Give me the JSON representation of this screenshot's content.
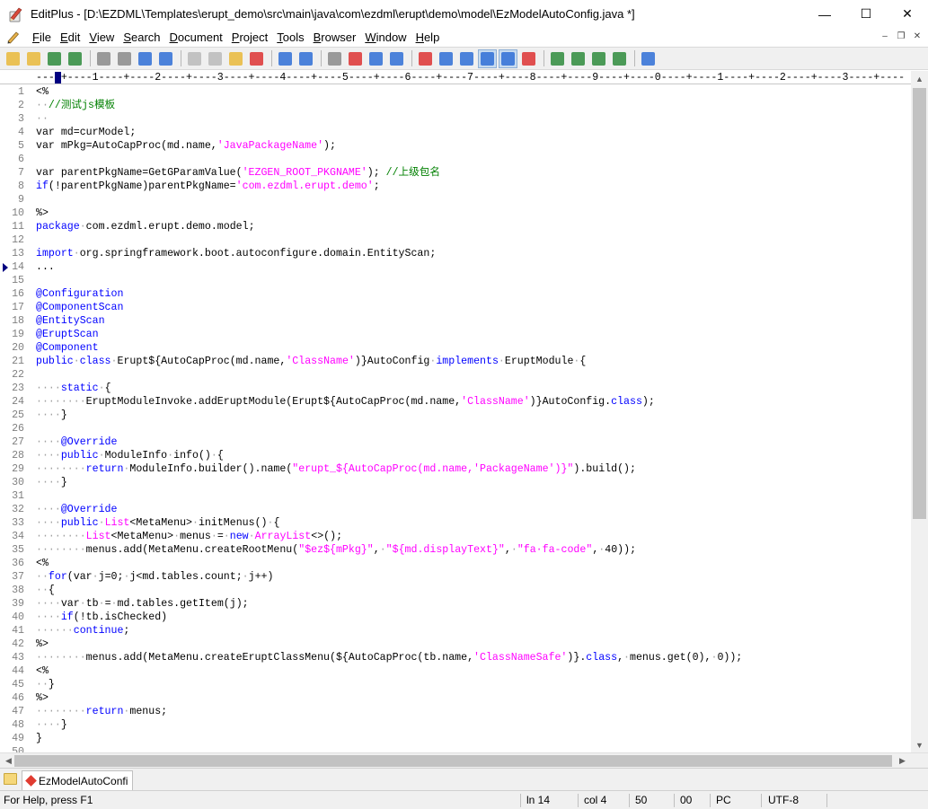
{
  "window": {
    "title": "EditPlus - [D:\\EZDML\\Templates\\erupt_demo\\src\\main\\java\\com\\ezdml\\erupt\\demo\\model\\EzModelAutoConfig.java *]",
    "minimize_glyph": "—",
    "maximize_glyph": "☐",
    "close_glyph": "✕"
  },
  "menu": {
    "items": [
      "File",
      "Edit",
      "View",
      "Search",
      "Document",
      "Project",
      "Tools",
      "Browser",
      "Window",
      "Help"
    ],
    "mdi_minimize": "–",
    "mdi_restore": "❐",
    "mdi_close": "✕"
  },
  "toolbar": {
    "icons": [
      "new-file-icon",
      "open-file-icon",
      "save-icon",
      "save-all-icon",
      "print-preview-icon",
      "print-icon",
      "spell-check-icon",
      "browser-preview-icon",
      "cut-icon",
      "copy-icon",
      "paste-icon",
      "delete-icon",
      "undo-icon",
      "redo-icon",
      "find-icon",
      "replace-icon",
      "find-in-files-icon",
      "go-to-icon",
      "font-icon",
      "hx-icon",
      "word-wrap-icon",
      "line-numbers-icon",
      "ruler-icon",
      "check-icon",
      "cliptext-icon",
      "directory-icon",
      "output-icon",
      "full-screen-icon",
      "help-icon"
    ],
    "colors": {
      "blue": "#2f6fd6",
      "green": "#2e8b3c",
      "red": "#d33",
      "yellow": "#e9b93a",
      "gray": "#8a8a8a"
    }
  },
  "ruler": {
    "text": "----+----1----+----2----+----3----+----4----+----5----+----6----+----7----+----8----+----9----+----0----+----1----+----2----+----3----+----"
  },
  "editor": {
    "current_line": 14,
    "colors": {
      "keyword": "#0000ff",
      "string": "#ff00ff",
      "comment": "#008000",
      "whitespace_dot": "#a0a0a0",
      "line_number": "#808080"
    },
    "lines": [
      {
        "n": "1",
        "t": [
          [
            "t",
            "<%"
          ]
        ]
      },
      {
        "n": "2",
        "t": [
          [
            "d",
            "··"
          ],
          [
            "c",
            "//测试js模板"
          ]
        ]
      },
      {
        "n": "3",
        "t": [
          [
            "d",
            "··"
          ]
        ]
      },
      {
        "n": "4",
        "t": [
          [
            "t",
            "var md=curModel;"
          ]
        ]
      },
      {
        "n": "5",
        "t": [
          [
            "t",
            "var mPkg=AutoCapProc(md.name,"
          ],
          [
            "s",
            "'JavaPackageName'"
          ],
          [
            "t",
            ");"
          ]
        ]
      },
      {
        "n": "6",
        "t": []
      },
      {
        "n": "7",
        "t": [
          [
            "t",
            "var parentPkgName=GetGParamValue("
          ],
          [
            "s",
            "'EZGEN_ROOT_PKGNAME'"
          ],
          [
            "t",
            "); "
          ],
          [
            "c",
            "//上级包名"
          ]
        ]
      },
      {
        "n": "8",
        "t": [
          [
            "k",
            "if"
          ],
          [
            "t",
            "(!parentPkgName)parentPkgName="
          ],
          [
            "s",
            "'com.ezdml.erupt.demo'"
          ],
          [
            "t",
            ";"
          ]
        ]
      },
      {
        "n": "9",
        "t": []
      },
      {
        "n": "10",
        "t": [
          [
            "t",
            "%>"
          ]
        ]
      },
      {
        "n": "11",
        "t": [
          [
            "k",
            "package"
          ],
          [
            "d",
            "·"
          ],
          [
            "t",
            "com.ezdml.erupt.demo.model;"
          ]
        ]
      },
      {
        "n": "12",
        "t": []
      },
      {
        "n": "13",
        "t": [
          [
            "k",
            "import"
          ],
          [
            "d",
            "·"
          ],
          [
            "t",
            "org.springframework.boot.autoconfigure.domain.EntityScan;"
          ]
        ]
      },
      {
        "n": "14",
        "t": [
          [
            "t",
            "..."
          ]
        ]
      },
      {
        "n": "15",
        "t": []
      },
      {
        "n": "16",
        "t": [
          [
            "k",
            "@Configuration"
          ]
        ]
      },
      {
        "n": "17",
        "t": [
          [
            "k",
            "@ComponentScan"
          ]
        ]
      },
      {
        "n": "18",
        "t": [
          [
            "k",
            "@EntityScan"
          ]
        ]
      },
      {
        "n": "19",
        "t": [
          [
            "k",
            "@EruptScan"
          ]
        ]
      },
      {
        "n": "20",
        "t": [
          [
            "k",
            "@Component"
          ]
        ]
      },
      {
        "n": "21",
        "t": [
          [
            "k",
            "public"
          ],
          [
            "d",
            "·"
          ],
          [
            "k",
            "class"
          ],
          [
            "d",
            "·"
          ],
          [
            "t",
            "Erupt${AutoCapProc(md.name,"
          ],
          [
            "s",
            "'ClassName'"
          ],
          [
            "t",
            ")}AutoConfig"
          ],
          [
            "d",
            "·"
          ],
          [
            "k",
            "implements"
          ],
          [
            "d",
            "·"
          ],
          [
            "t",
            "EruptModule"
          ],
          [
            "d",
            "·"
          ],
          [
            "t",
            "{"
          ]
        ]
      },
      {
        "n": "22",
        "t": []
      },
      {
        "n": "23",
        "t": [
          [
            "d",
            "····"
          ],
          [
            "k",
            "static"
          ],
          [
            "d",
            "·"
          ],
          [
            "t",
            "{"
          ]
        ]
      },
      {
        "n": "24",
        "t": [
          [
            "d",
            "········"
          ],
          [
            "t",
            "EruptModuleInvoke.addEruptModule(Erupt${AutoCapProc(md.name,"
          ],
          [
            "s",
            "'ClassName'"
          ],
          [
            "t",
            ")}AutoConfig."
          ],
          [
            "k",
            "class"
          ],
          [
            "t",
            ");"
          ]
        ]
      },
      {
        "n": "25",
        "t": [
          [
            "d",
            "····"
          ],
          [
            "t",
            "}"
          ]
        ]
      },
      {
        "n": "26",
        "t": []
      },
      {
        "n": "27",
        "t": [
          [
            "d",
            "····"
          ],
          [
            "k",
            "@Override"
          ]
        ]
      },
      {
        "n": "28",
        "t": [
          [
            "d",
            "····"
          ],
          [
            "k",
            "public"
          ],
          [
            "d",
            "·"
          ],
          [
            "t",
            "ModuleInfo"
          ],
          [
            "d",
            "·"
          ],
          [
            "t",
            "info()"
          ],
          [
            "d",
            "·"
          ],
          [
            "t",
            "{"
          ]
        ]
      },
      {
        "n": "29",
        "t": [
          [
            "d",
            "········"
          ],
          [
            "k",
            "return"
          ],
          [
            "d",
            "·"
          ],
          [
            "t",
            "ModuleInfo.builder().name("
          ],
          [
            "s",
            "\"erupt_${AutoCapProc(md.name,'PackageName')}\""
          ],
          [
            "t",
            ").build();"
          ]
        ]
      },
      {
        "n": "30",
        "t": [
          [
            "d",
            "····"
          ],
          [
            "t",
            "}"
          ]
        ]
      },
      {
        "n": "31",
        "t": []
      },
      {
        "n": "32",
        "t": [
          [
            "d",
            "····"
          ],
          [
            "k",
            "@Override"
          ]
        ]
      },
      {
        "n": "33",
        "t": [
          [
            "d",
            "····"
          ],
          [
            "k",
            "public"
          ],
          [
            "d",
            "·"
          ],
          [
            "s",
            "List"
          ],
          [
            "t",
            "<MetaMenu>"
          ],
          [
            "d",
            "·"
          ],
          [
            "t",
            "initMenus()"
          ],
          [
            "d",
            "·"
          ],
          [
            "t",
            "{"
          ]
        ]
      },
      {
        "n": "34",
        "t": [
          [
            "d",
            "········"
          ],
          [
            "s",
            "List"
          ],
          [
            "t",
            "<MetaMenu>"
          ],
          [
            "d",
            "·"
          ],
          [
            "t",
            "menus"
          ],
          [
            "d",
            "·"
          ],
          [
            "t",
            "="
          ],
          [
            "d",
            "·"
          ],
          [
            "k",
            "new"
          ],
          [
            "d",
            "·"
          ],
          [
            "s",
            "ArrayList"
          ],
          [
            "t",
            "<>();"
          ]
        ]
      },
      {
        "n": "35",
        "t": [
          [
            "d",
            "········"
          ],
          [
            "t",
            "menus.add(MetaMenu.createRootMenu("
          ],
          [
            "s",
            "\"$ez${mPkg}\""
          ],
          [
            "t",
            ","
          ],
          [
            "d",
            "·"
          ],
          [
            "s",
            "\"${md.displayText}\""
          ],
          [
            "t",
            ","
          ],
          [
            "d",
            "·"
          ],
          [
            "s",
            "\"fa·fa-code\""
          ],
          [
            "t",
            ","
          ],
          [
            "d",
            "·"
          ],
          [
            "t",
            "40));"
          ]
        ]
      },
      {
        "n": "36",
        "t": [
          [
            "t",
            "<%"
          ]
        ]
      },
      {
        "n": "37",
        "t": [
          [
            "d",
            "··"
          ],
          [
            "k",
            "for"
          ],
          [
            "t",
            "(var"
          ],
          [
            "d",
            "·"
          ],
          [
            "t",
            "j=0;"
          ],
          [
            "d",
            "·"
          ],
          [
            "t",
            "j<md.tables.count;"
          ],
          [
            "d",
            "·"
          ],
          [
            "t",
            "j++)"
          ]
        ]
      },
      {
        "n": "38",
        "t": [
          [
            "d",
            "··"
          ],
          [
            "t",
            "{"
          ]
        ]
      },
      {
        "n": "39",
        "t": [
          [
            "d",
            "····"
          ],
          [
            "t",
            "var"
          ],
          [
            "d",
            "·"
          ],
          [
            "t",
            "tb"
          ],
          [
            "d",
            "·"
          ],
          [
            "t",
            "="
          ],
          [
            "d",
            "·"
          ],
          [
            "t",
            "md.tables.getItem(j);"
          ]
        ]
      },
      {
        "n": "40",
        "t": [
          [
            "d",
            "····"
          ],
          [
            "k",
            "if"
          ],
          [
            "t",
            "(!tb.isChecked)"
          ]
        ]
      },
      {
        "n": "41",
        "t": [
          [
            "d",
            "······"
          ],
          [
            "k",
            "continue"
          ],
          [
            "t",
            ";"
          ]
        ]
      },
      {
        "n": "42",
        "t": [
          [
            "t",
            "%>"
          ]
        ]
      },
      {
        "n": "43",
        "t": [
          [
            "d",
            "········"
          ],
          [
            "t",
            "menus.add(MetaMenu.createEruptClassMenu(${AutoCapProc(tb.name,"
          ],
          [
            "s",
            "'ClassNameSafe'"
          ],
          [
            "t",
            ")}."
          ],
          [
            "k",
            "class"
          ],
          [
            "t",
            ","
          ],
          [
            "d",
            "·"
          ],
          [
            "t",
            "menus.get(0),"
          ],
          [
            "d",
            "·"
          ],
          [
            "t",
            "0));"
          ]
        ]
      },
      {
        "n": "44",
        "t": [
          [
            "t",
            "<%"
          ]
        ]
      },
      {
        "n": "45",
        "t": [
          [
            "d",
            "··"
          ],
          [
            "t",
            "}"
          ]
        ]
      },
      {
        "n": "46",
        "t": [
          [
            "t",
            "%>"
          ]
        ]
      },
      {
        "n": "47",
        "t": [
          [
            "d",
            "········"
          ],
          [
            "k",
            "return"
          ],
          [
            "d",
            "·"
          ],
          [
            "t",
            "menus;"
          ]
        ]
      },
      {
        "n": "48",
        "t": [
          [
            "d",
            "····"
          ],
          [
            "t",
            "}"
          ]
        ]
      },
      {
        "n": "49",
        "t": [
          [
            "t",
            "}"
          ]
        ]
      },
      {
        "n": "50",
        "t": []
      }
    ]
  },
  "scroll": {
    "up": "▲",
    "down": "▼",
    "left": "◀",
    "right": "▶"
  },
  "tabs": [
    {
      "label": "EzModelAutoConfi"
    }
  ],
  "status": {
    "help": "For Help, press F1",
    "line": "ln 14",
    "col": "col 4",
    "num": "50",
    "code": "00",
    "eol": "PC",
    "encoding": "UTF-8"
  }
}
